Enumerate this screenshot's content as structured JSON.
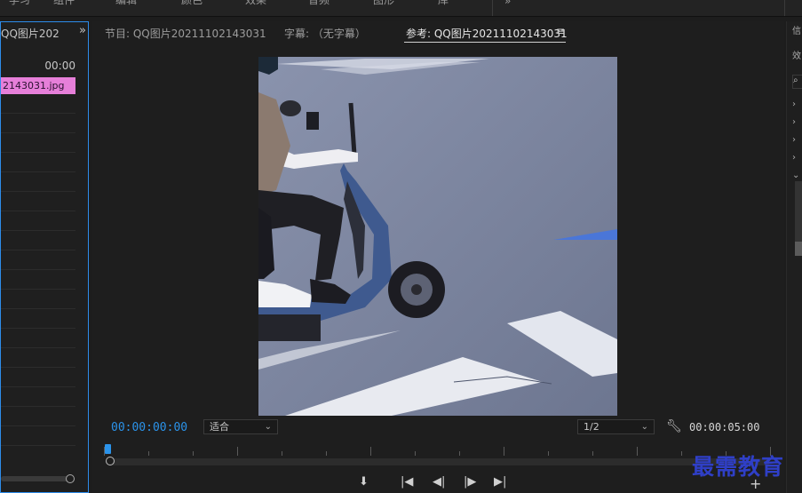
{
  "top_menu": {
    "items": [
      "学习",
      "组件",
      "编辑",
      "颜色",
      "效果",
      "音频",
      "图形",
      "库"
    ],
    "overflow": "»"
  },
  "left_panel": {
    "tab_label": "QQ图片202",
    "expand_icon": "»",
    "time": "00:00",
    "clip_name": "2143031.jpg"
  },
  "monitor": {
    "tabs": [
      {
        "label": "节目: QQ图片20211102143031",
        "active": false
      },
      {
        "label": "字幕: （无字幕）",
        "active": false
      },
      {
        "label": "参考: QQ图片20211102143031",
        "active": true
      }
    ],
    "menu_icon": "≡",
    "timecode_current": "00:00:00:00",
    "fit_select": "适合",
    "resolution_select": "1/2",
    "timecode_duration": "00:00:05:00"
  },
  "transport": {
    "marker_icon": "marker-icon",
    "go_to_in_icon": "go-to-in-icon",
    "step_back_icon": "step-back-icon",
    "step_forward_icon": "step-forward-icon",
    "go_to_out_icon": "go-to-out-icon",
    "add_icon": "+"
  },
  "watermark": "最需教育",
  "colors": {
    "accent_blue": "#2b93ea",
    "clip_pink": "#e67fd9",
    "watermark_blue": "#2f3fc7"
  }
}
